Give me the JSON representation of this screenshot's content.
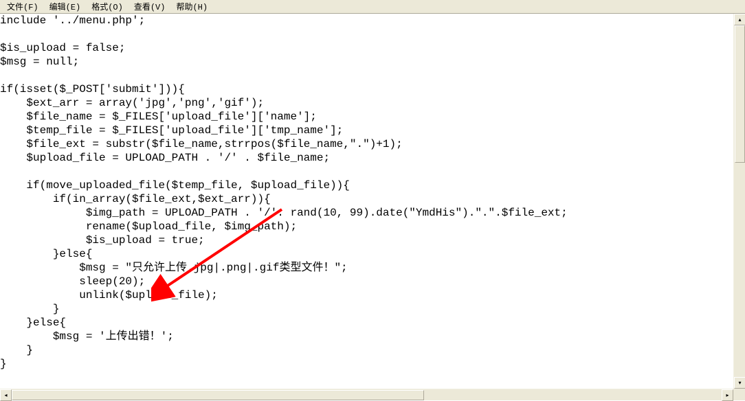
{
  "menubar": {
    "file": "文件(F)",
    "edit": "编辑(E)",
    "format": "格式(O)",
    "view": "查看(V)",
    "help": "帮助(H)"
  },
  "code": {
    "line1": "include '../menu.php';",
    "line2": "",
    "line3": "$is_upload = false;",
    "line4": "$msg = null;",
    "line5": "",
    "line6": "if(isset($_POST['submit'])){",
    "line7": "    $ext_arr = array('jpg','png','gif');",
    "line8": "    $file_name = $_FILES['upload_file']['name'];",
    "line9": "    $temp_file = $_FILES['upload_file']['tmp_name'];",
    "line10": "    $file_ext = substr($file_name,strrpos($file_name,\".\")+1);",
    "line11": "    $upload_file = UPLOAD_PATH . '/' . $file_name;",
    "line12": "",
    "line13": "    if(move_uploaded_file($temp_file, $upload_file)){",
    "line14": "        if(in_array($file_ext,$ext_arr)){",
    "line15": "             $img_path = UPLOAD_PATH . '/'. rand(10, 99).date(\"YmdHis\").\".\".$file_ext;",
    "line16": "             rename($upload_file, $img_path);",
    "line17": "             $is_upload = true;",
    "line18": "        }else{",
    "line19": "            $msg = \"只允许上传.jpg|.png|.gif类型文件！\";",
    "line20": "            sleep(20);",
    "line21": "            unlink($upload_file);",
    "line22": "        }",
    "line23": "    }else{",
    "line24": "        $msg = '上传出错！';",
    "line25": "    }",
    "line26": "}"
  },
  "annotation": {
    "arrow_color": "#ff0000"
  }
}
